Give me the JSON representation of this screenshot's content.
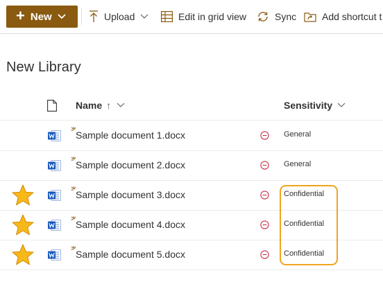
{
  "command_bar": {
    "new_label": "New",
    "upload_label": "Upload",
    "grid_label": "Edit in grid view",
    "sync_label": "Sync",
    "shortcut_label": "Add shortcut t"
  },
  "library": {
    "title": "New Library"
  },
  "columns": {
    "name": "Name",
    "sort_indicator": "↑",
    "sensitivity": "Sensitivity"
  },
  "rows": [
    {
      "name": "Sample document 1.docx",
      "sensitivity": "General",
      "starred": false
    },
    {
      "name": "Sample document 2.docx",
      "sensitivity": "General",
      "starred": false
    },
    {
      "name": "Sample document 3.docx",
      "sensitivity": "Confidential",
      "starred": true
    },
    {
      "name": "Sample document 4.docx",
      "sensitivity": "Confidential",
      "starred": true
    },
    {
      "name": "Sample document 5.docx",
      "sensitivity": "Confidential",
      "starred": true
    }
  ],
  "colors": {
    "brand": "#8a5a10",
    "highlight": "#f0a31c",
    "star": "#f7b91a",
    "word_blue": "#185abd",
    "sensitivity_icon": "#c4314b"
  }
}
